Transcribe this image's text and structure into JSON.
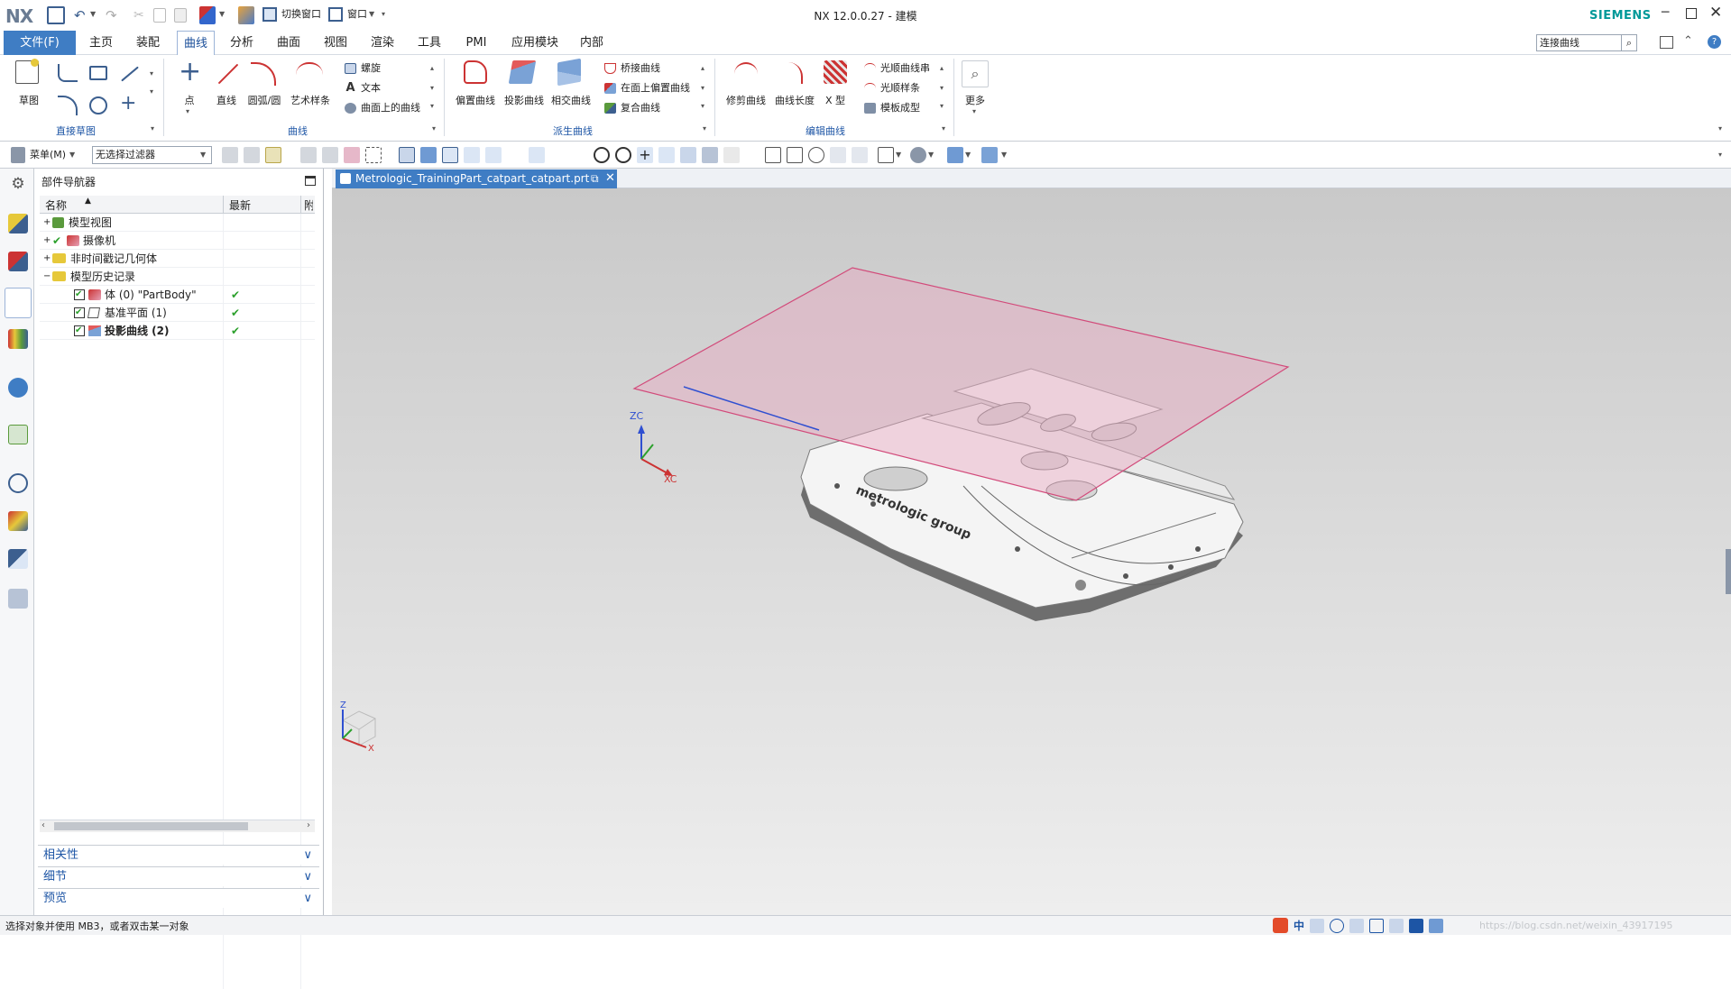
{
  "titlebar": {
    "app_logo": "NX",
    "quick_switch_window": "切换窗口",
    "quick_window": "窗口",
    "title": "NX 12.0.0.27 - 建模",
    "brand": "SIEMENS"
  },
  "menubar": {
    "tabs": [
      {
        "label": "文件(F)"
      },
      {
        "label": "主页"
      },
      {
        "label": "装配"
      },
      {
        "label": "曲线"
      },
      {
        "label": "分析"
      },
      {
        "label": "曲面"
      },
      {
        "label": "视图"
      },
      {
        "label": "渲染"
      },
      {
        "label": "工具"
      },
      {
        "label": "PMI"
      },
      {
        "label": "应用模块"
      },
      {
        "label": "内部"
      }
    ],
    "active_tab": "曲线",
    "search_value": "连接曲线"
  },
  "ribbon": {
    "direct_sketch": {
      "sketch_label": "草图",
      "group_label": "直接草图"
    },
    "curve": {
      "point_label": "点",
      "line_label": "直线",
      "arc_label": "圆弧/圆",
      "studio_spline_label": "艺术样条",
      "helix_label": "螺旋",
      "text_label": "文本",
      "curve_on_surface_label": "曲面上的曲线",
      "group_label": "曲线"
    },
    "derived": {
      "offset_label": "偏置曲线",
      "project_label": "投影曲线",
      "intersect_label": "相交曲线",
      "bridge_label": "桥接曲线",
      "offset_in_face_label": "在面上偏置曲线",
      "composite_label": "复合曲线",
      "group_label": "派生曲线"
    },
    "edit": {
      "trim_label": "修剪曲线",
      "length_label": "曲线长度",
      "xform_label": "X 型",
      "smooth_string_label": "光顺曲线串",
      "smooth_spline_label": "光顺样条",
      "template_label": "模板成型",
      "group_label": "编辑曲线"
    },
    "more_label": "更多"
  },
  "toolbar2": {
    "menu_label": "菜单(M)",
    "filter_value": "无选择过滤器"
  },
  "navigator": {
    "title": "部件导航器",
    "col_name": "名称",
    "col_latest": "最新",
    "col_extra": "附",
    "rows": [
      {
        "label": "模型视图"
      },
      {
        "label": "摄像机"
      },
      {
        "label": "非时间戳记几何体"
      },
      {
        "label": "模型历史记录"
      },
      {
        "label": "体 (0) \"PartBody\""
      },
      {
        "label": "基准平面 (1)"
      },
      {
        "label": "投影曲线 (2)"
      }
    ],
    "accordion": [
      {
        "label": "相关性"
      },
      {
        "label": "细节"
      },
      {
        "label": "预览"
      }
    ]
  },
  "viewport": {
    "tab_label": "Metrologic_TrainingPart_catpart_catpart.prt",
    "part_engraving": "metrologic group",
    "axis_zc": "ZC",
    "axis_xc": "XC",
    "triad_z": "Z",
    "triad_x": "X"
  },
  "statusbar": {
    "message": "选择对象并使用 MB3，或者双击某一对象",
    "ime_label": "中",
    "watermark": "https://blog.csdn.net/weixin_43917195"
  },
  "colors": {
    "accent_blue": "#3f7dc4",
    "group_label_blue": "#1d55a5",
    "datum_plane_fill": "#e8a8c0",
    "datum_plane_edge": "#d24a7a",
    "check_green": "#2ca02c",
    "brand_teal": "#009999"
  }
}
